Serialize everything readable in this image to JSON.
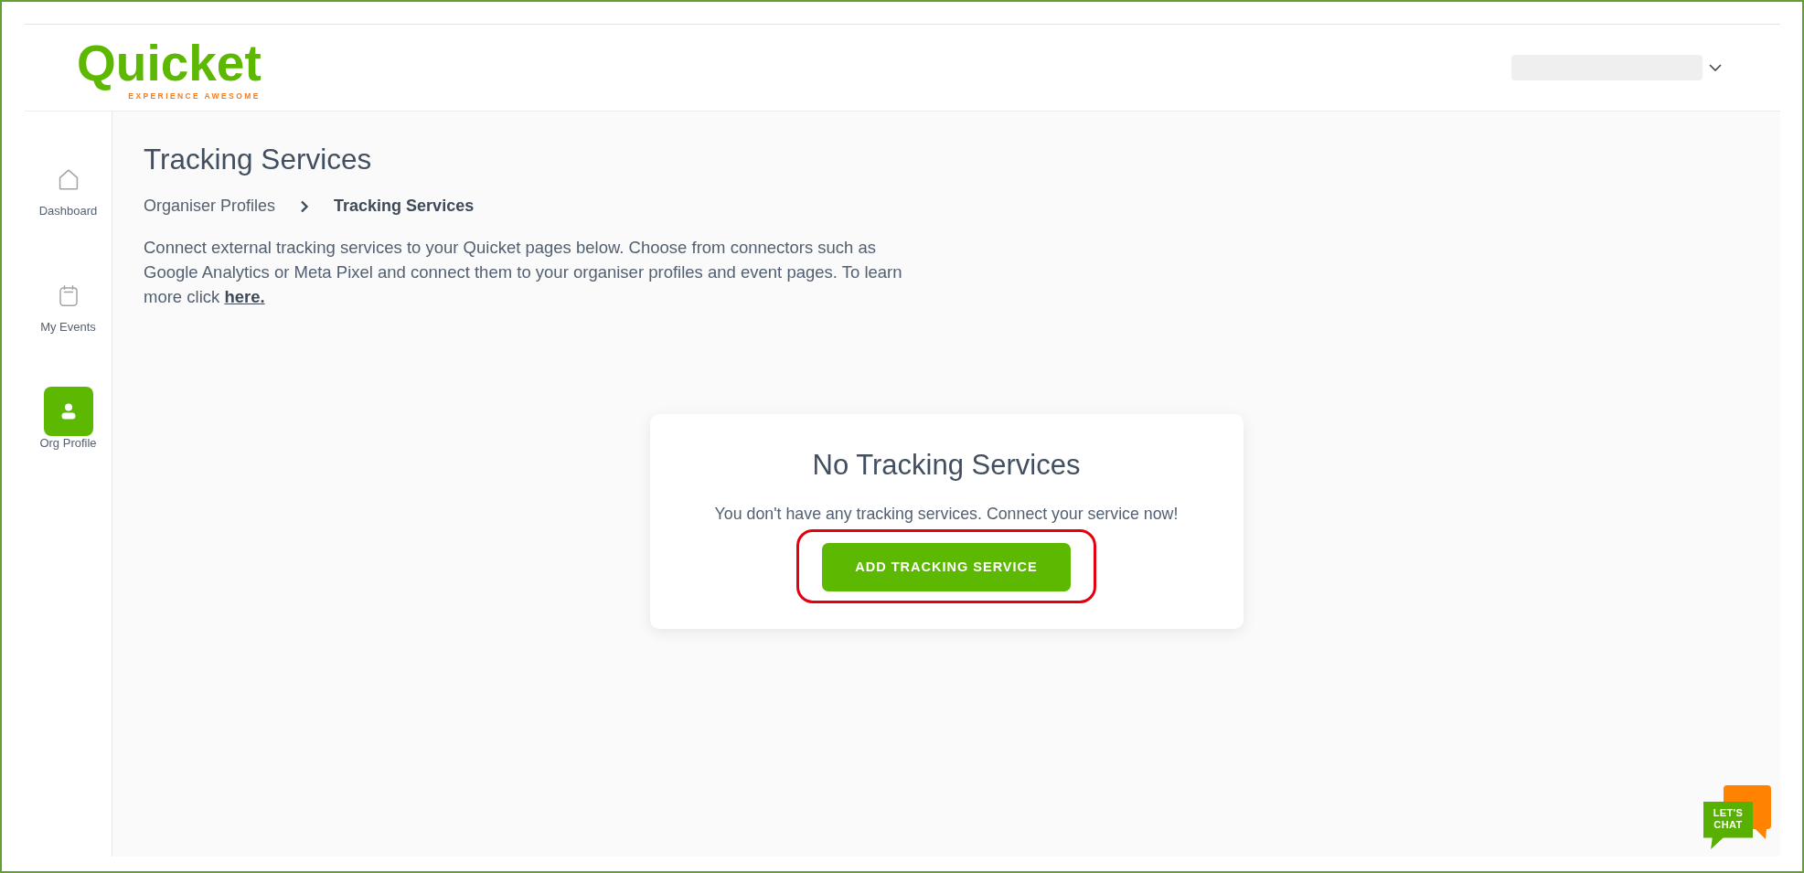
{
  "header": {
    "logo": {
      "name": "Quicket",
      "tagline": "EXPERIENCE AWESOME"
    }
  },
  "sidebar": {
    "items": [
      {
        "label": "Dashboard",
        "selected": false
      },
      {
        "label": "My Events",
        "selected": false
      },
      {
        "label": "Org Profile",
        "selected": true
      }
    ]
  },
  "page": {
    "title": "Tracking Services",
    "breadcrumb": [
      {
        "label": "Organiser Profiles",
        "current": false
      },
      {
        "label": "Tracking Services",
        "current": true
      }
    ],
    "description": {
      "lines": [
        "Connect external tracking services to your Quicket pages below. Choose from connectors such as",
        "Google Analytics or Meta Pixel and connect them to your organiser profiles and event pages. To learn",
        "more click"
      ],
      "link": "here."
    }
  },
  "empty_state": {
    "title": "No Tracking Services",
    "message": "You don't have any tracking services. Connect your service now!",
    "button": "ADD TRACKING SERVICE",
    "highlighted": true
  },
  "chat_widget": {
    "label": "LET'S CHAT"
  }
}
